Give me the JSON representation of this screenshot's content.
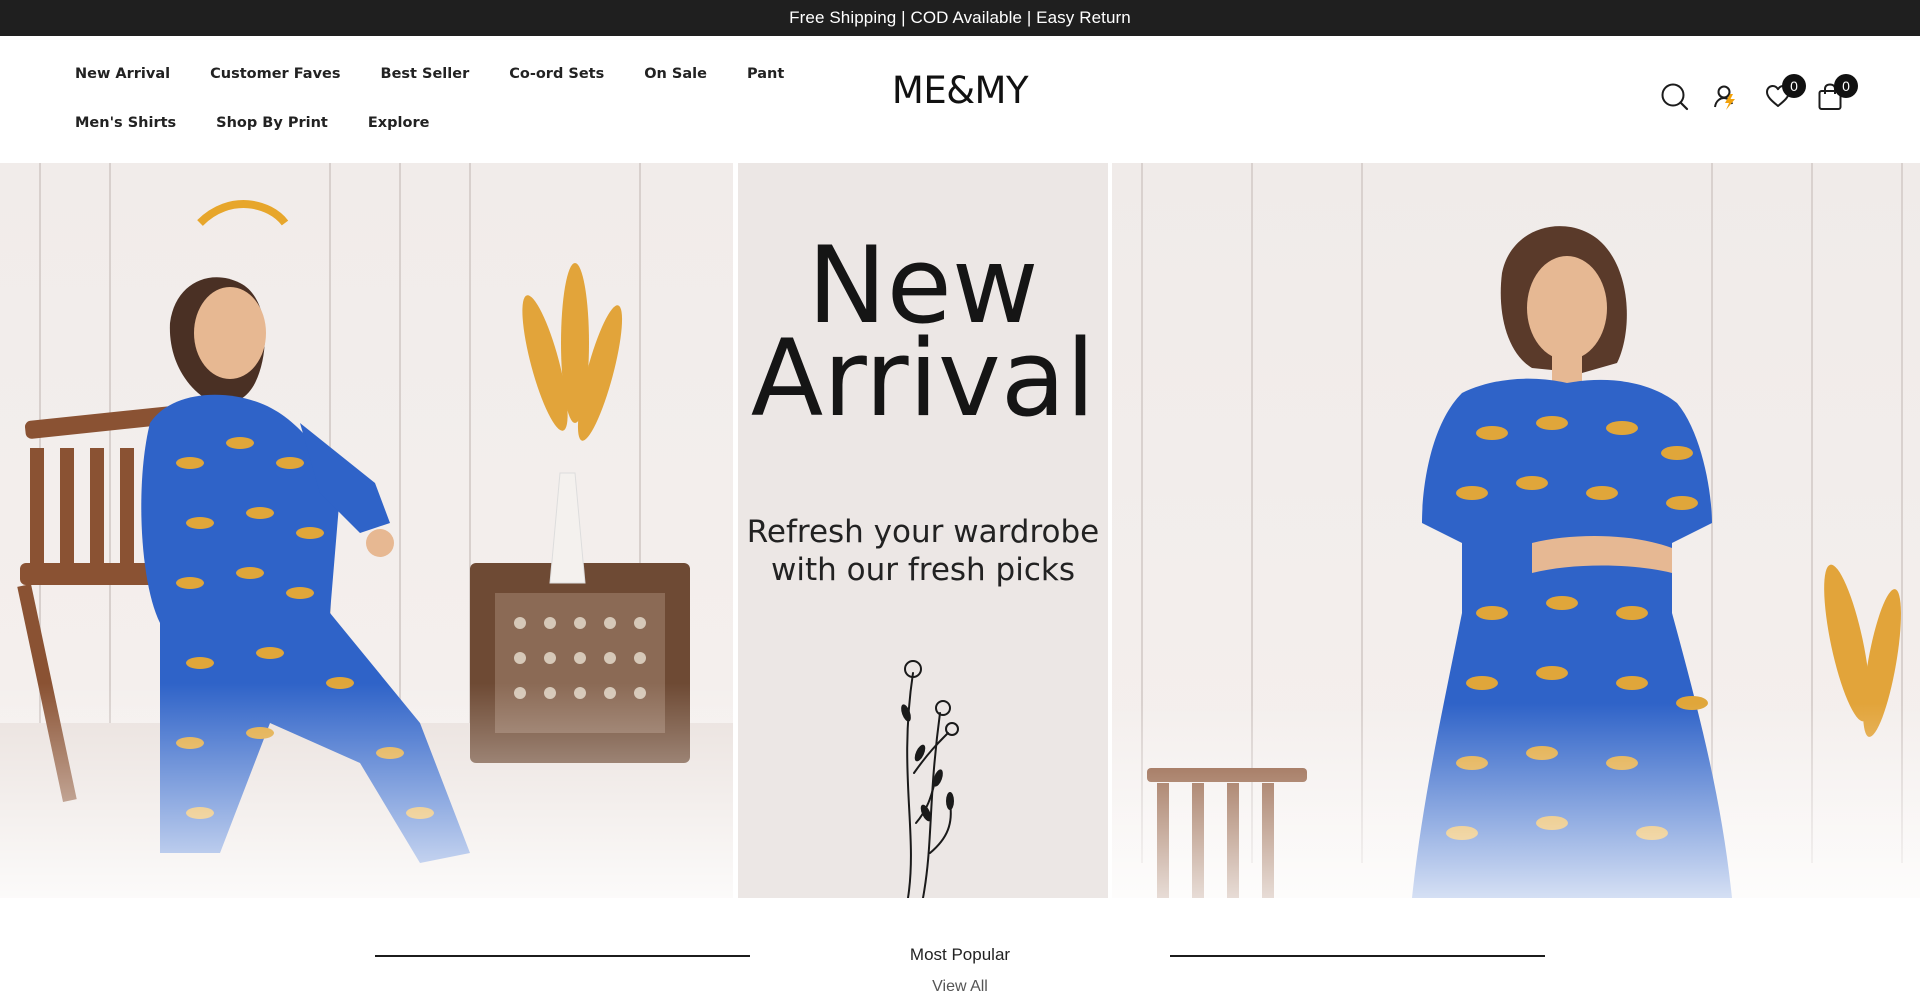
{
  "announcement": "Free Shipping | COD Available | Easy Return",
  "nav": {
    "row1": [
      "New Arrival",
      "Customer Faves",
      "Best Seller",
      "Co-ord Sets",
      "On Sale",
      "Pant"
    ],
    "row2": [
      "Men's Shirts",
      "Shop By Print",
      "Explore"
    ]
  },
  "logo": "ME&MY",
  "header_icons": {
    "search": "search-icon",
    "account": "account-icon",
    "wishlist": "heart-icon",
    "cart": "bag-icon",
    "wishlist_count": "0",
    "cart_count": "0"
  },
  "hero": {
    "title_line1": "New",
    "title_line2": "Arrival",
    "subtitle_line1": "Refresh your wardrobe",
    "subtitle_line2": "with our fresh picks",
    "dress_color": "#2f63c8",
    "print_color": "#e0a63a"
  },
  "most_popular": {
    "title": "Most Popular",
    "link": "View All"
  },
  "colors": {
    "announcement_bg": "#1f1f1f",
    "accent_orange": "#f2a20c"
  }
}
